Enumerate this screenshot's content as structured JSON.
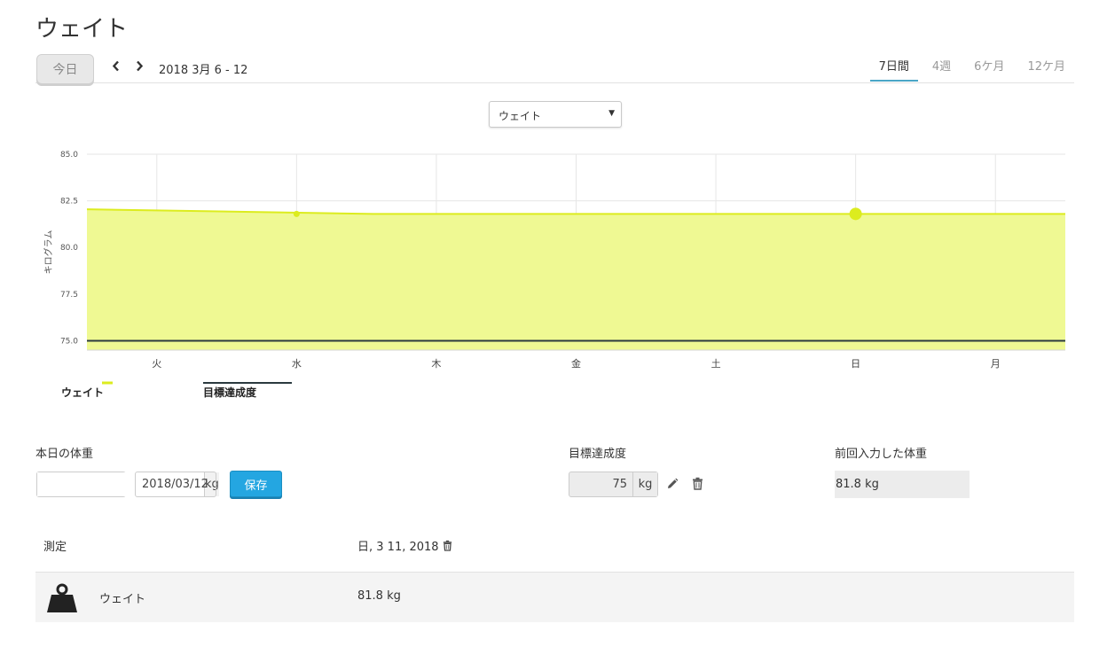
{
  "page": {
    "title": "ウェイト"
  },
  "toolbar": {
    "today_label": "今日",
    "date_range": "2018 3月 6 - 12",
    "tabs": [
      {
        "label": "7日間",
        "active": true
      },
      {
        "label": "4週",
        "active": false
      },
      {
        "label": "6ケ月",
        "active": false
      },
      {
        "label": "12ケ月",
        "active": false
      }
    ]
  },
  "metric_select": {
    "value": "ウェイト"
  },
  "chart_data": {
    "type": "area",
    "categories": [
      "火",
      "水",
      "木",
      "金",
      "土",
      "日",
      "月"
    ],
    "ylabel": "キログラム",
    "ylim": [
      74.5,
      85.0
    ],
    "yticks": [
      "75.0",
      "77.5",
      "80.0",
      "82.5",
      "85.0"
    ],
    "grid": true,
    "series": [
      {
        "name": "ウェイト",
        "type": "area",
        "color": "#dcec1f",
        "fill": "#eff993",
        "points": [
          {
            "x": 0,
            "y": 82.05
          },
          {
            "x": 1.55,
            "y": 81.8
          },
          {
            "x": 7.1,
            "y": 81.8
          }
        ]
      },
      {
        "name": "目標達成度",
        "type": "line",
        "color": "#2b3a3f",
        "value": 75.0
      }
    ],
    "markers": [
      {
        "x": 1,
        "y": 81.8,
        "size": "small"
      },
      {
        "x": 5,
        "y": 81.8,
        "size": "large"
      }
    ]
  },
  "legend": [
    {
      "label": "ウェイト",
      "color": "#dcec1f"
    },
    {
      "label": "目標達成度",
      "color": "#2b3a3f"
    }
  ],
  "today_weight": {
    "label": "本日の体重",
    "value": "",
    "unit": "kg",
    "date": "2018/03/12",
    "save_label": "保存"
  },
  "goal": {
    "label": "目標達成度",
    "value": "75",
    "unit": "kg"
  },
  "last_weight": {
    "label": "前回入力した体重",
    "value": "81.8 kg"
  },
  "measurements": {
    "header_label": "測定",
    "date": "日, 3 11, 2018",
    "rows": [
      {
        "name": "ウェイト",
        "value": "81.8  kg"
      }
    ]
  },
  "colors": {
    "accent_blue": "#24a6e1",
    "tab_underline": "#4aa6c6",
    "weight_line": "#dcec1f",
    "goal_line": "#2b3a3f"
  }
}
